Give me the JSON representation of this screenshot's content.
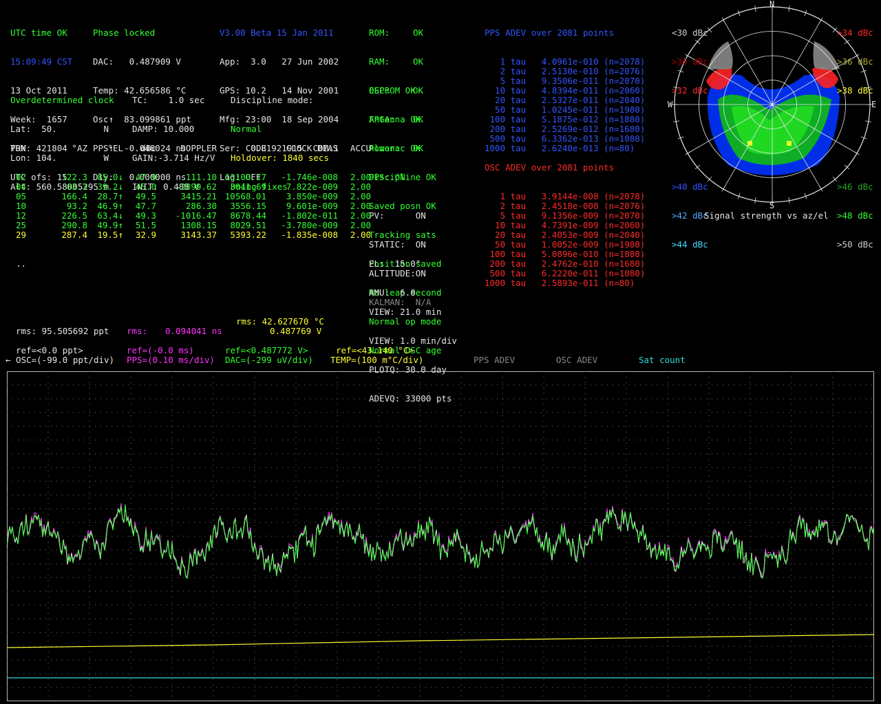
{
  "status": {
    "col1": [
      "UTC time OK",
      "15:09:49 CST",
      "13 Oct 2011",
      "Week:  1657",
      "TOW: 421804",
      "UTC ofs: 15"
    ],
    "col2": [
      "Phase locked",
      "DAC:   0.487909 V",
      "Temp: 42.656586 °C",
      "Osc↑  83.099861 ppt",
      "PPS↑  -0.046024 ns",
      "Dly:   0.000000 ns"
    ],
    "col3": [
      "V3.00 Beta 15 Jan 2011",
      "App:  3.0   27 Jun 2002",
      "GPS: 10.2   14 Nov 2001",
      "Mfg: 23:00  18 Sep 2004",
      "Ser:  0.81921915  COM:1",
      "Log: OFF"
    ]
  },
  "health": [
    {
      "label": "ROM:",
      "value": "OK"
    },
    {
      "label": "RAM:",
      "value": "OK"
    },
    {
      "label": "OSC:",
      "value": "OK"
    },
    {
      "label": "FPGA:",
      "value": "OK"
    },
    {
      "label": "Power:",
      "value": "OK"
    }
  ],
  "health2": [
    "EEPROM OK",
    "Antenna OK",
    "Almanac OK",
    "Discipline OK",
    "Saved posn OK",
    "Tracking sats",
    "Position saved",
    "No leap second",
    "Normal op mode",
    "Normal OSC age"
  ],
  "pps_line": "PPS: ON",
  "pv": [
    "PV:      ON",
    "STATIC:  ON",
    "ALTITUDE:ON"
  ],
  "kalman": "KALMAN:  N/A",
  "el_amu": [
    "EL:  15.0°",
    "AMU:  6.0"
  ],
  "view": [
    "VIEW: 21.0 min",
    "VIEW: 1.0 min/div",
    "PLOTQ: 30.0 day",
    "ADEVQ: 33000 pts"
  ],
  "clock": {
    "mode": "Overdetermined clock",
    "lat": "Lat:  50.         N",
    "lon": "Lon: 104.         W",
    "alt": "Alt: 560.58005295 m",
    "tc": "TC:    1.0 sec",
    "damp": "DAMP: 10.000",
    "gain": "GAIN:-3.714 Hz/V",
    "init": "INIT: 0.488 V",
    "disc_title": "Discipline mode:",
    "disc_mode": "Normal",
    "holdover": "Holdover: 1840 secs",
    "fixes": "Doing fixes"
  },
  "sat_table": {
    "headers": [
      "PRN",
      "°AZ",
      "°EL",
      "dBc",
      "DOPPLER",
      "CODE",
      "CLOCK BIAS",
      "ACCU"
    ],
    "rows": [
      [
        "02",
        "122.3",
        "85.0↓",
        "47.9",
        "111.10",
        "13100.17",
        "-1.746e-008",
        "2.00"
      ],
      [
        "04",
        "63.3",
        "39.2↓",
        "45.0",
        "-2899.62",
        "3041.69",
        "7.822e-009",
        "2.00"
      ],
      [
        "05",
        "166.4",
        "28.7↑",
        "49.5",
        "3415.21",
        "10568.01",
        "3.850e-009",
        "2.00"
      ],
      [
        "10",
        "93.2",
        "46.9↑",
        "47.7",
        "286.30",
        "3556.15",
        "9.601e-009",
        "2.00"
      ],
      [
        "12",
        "226.5",
        "63.4↓",
        "49.3",
        "-1016.47",
        "8678.44",
        "-1.802e-011",
        "2.00"
      ],
      [
        "25",
        "290.8",
        "49.9↑",
        "51.5",
        "1308.15",
        "8029.51",
        "-3.780e-009",
        "2.00"
      ],
      [
        "29",
        "287.4",
        "19.5↑",
        "32.9",
        "3143.37",
        "5393.22",
        "-1.835e-008",
        "2.00"
      ]
    ],
    "more": ".."
  },
  "pps_adev": {
    "title": "PPS ADEV over 2081 points",
    "rows": [
      "   1 tau   4.0961e-010 (n=2078)",
      "   2 tau   2.5130e-010 (n=2076)",
      "   5 tau   9.3506e-011 (n=2070)",
      "  10 tau   4.8394e-011 (n=2060)",
      "  20 tau   2.5327e-011 (n=2040)",
      "  50 tau   1.0245e-011 (n=1980)",
      " 100 tau   5.1875e-012 (n=1880)",
      " 200 tau   2.5269e-012 (n=1680)",
      " 500 tau   6.3362e-013 (n=1080)",
      "1000 tau   2.6240e-013 (n=80)"
    ]
  },
  "osc_adev": {
    "title": "OSC ADEV over 2081 points",
    "rows": [
      "   1 tau   3.9144e-008 (n=2078)",
      "   2 tau   2.4518e-008 (n=2076)",
      "   5 tau   9.1356e-009 (n=2070)",
      "  10 tau   4.7391e-009 (n=2060)",
      "  20 tau   2.4053e-009 (n=2040)",
      "  50 tau   1.0052e-009 (n=1980)",
      " 100 tau   5.0896e-010 (n=1880)",
      " 200 tau   2.4762e-010 (n=1680)",
      " 500 tau   6.2220e-011 (n=1080)",
      "1000 tau   2.5893e-011 (n=80)"
    ]
  },
  "polar": {
    "compass": {
      "n": "N",
      "s": "S",
      "e": "E",
      "w": "W"
    },
    "legend_left": [
      "<30 dBc",
      ">30 dBc",
      ">32 dBc"
    ],
    "legend_right": [
      ">34 dBc",
      ">36 dBc",
      ">38 dBc"
    ],
    "legend_left_bottom": [
      ">40 dBc",
      ">42 dBc",
      ">44 dBc"
    ],
    "legend_right_bottom": [
      ">46 dBc",
      ">48 dBc",
      ">50 dBc"
    ],
    "caption": "Signal strength vs az/el"
  },
  "rms": {
    "temp": "rms: 42.627670 °C",
    "dac": "0.487769 V",
    "osc": "rms: 95.505692 ppt",
    "pps_label": "rms:",
    "pps_val": "0.094041 ns"
  },
  "refs": {
    "osc_ref": "ref=<0.0 ppt>",
    "osc_div": "← OSC=(-99.0 ppt/div)",
    "pps_ref": "ref=(-0.0 ms)",
    "pps_div": "PPS=(0.10 ms/div)",
    "dac_ref": "ref=<0.487772 V>",
    "dac_div": "DAC=(-299 uV/div)",
    "temp_ref": "ref=<43.140 °C>",
    "temp_div": "TEMP=(100 m°C/div)",
    "btn_pps_adev": "PPS ADEV",
    "btn_osc_adev": "OSC ADEV",
    "btn_sat_count": "Sat count"
  },
  "colors": {
    "green": "#33ff33",
    "magenta": "#ff33ff",
    "yellow": "#ffff33",
    "cyan": "#33dddd",
    "blue": "#3355ff",
    "red": "#ff2a2a"
  }
}
